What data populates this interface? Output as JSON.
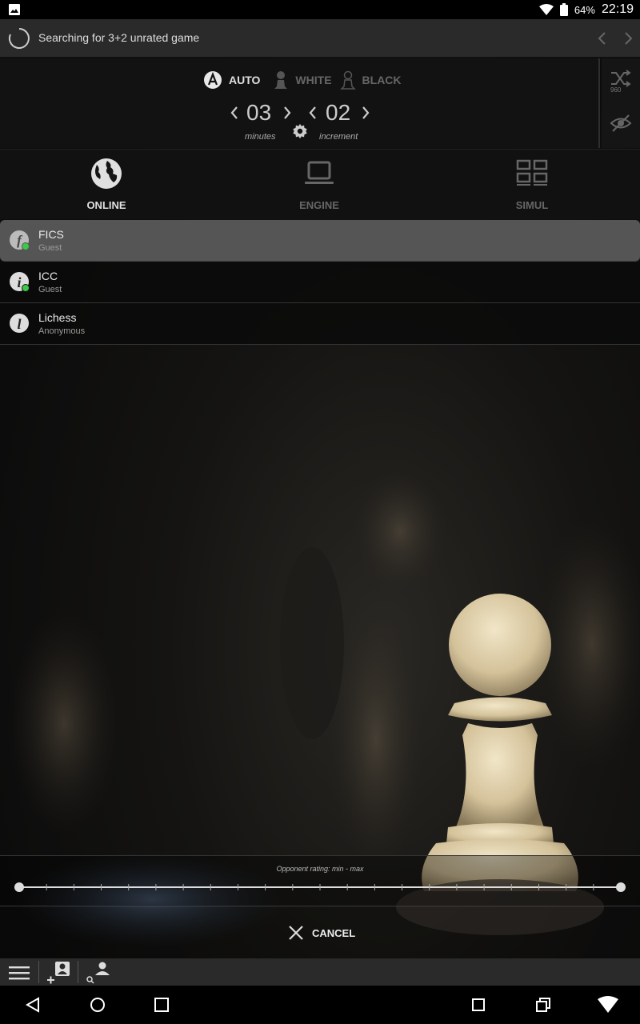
{
  "status_bar": {
    "battery": "64%",
    "time": "22:19"
  },
  "search": {
    "text": "Searching for 3+2 unrated game"
  },
  "color_options": [
    {
      "label": "AUTO",
      "selected": true
    },
    {
      "label": "WHITE",
      "selected": false
    },
    {
      "label": "BLACK",
      "selected": false
    }
  ],
  "time_control": {
    "minutes": "03",
    "minutes_label": "minutes",
    "increment": "02",
    "increment_label": "increment"
  },
  "side_buttons": {
    "chess960_label": "960"
  },
  "tabs": [
    {
      "label": "ONLINE",
      "icon": "globe-icon",
      "active": true
    },
    {
      "label": "ENGINE",
      "icon": "laptop-icon",
      "active": false
    },
    {
      "label": "SIMUL",
      "icon": "grid-icon",
      "active": false
    }
  ],
  "servers": [
    {
      "name": "FICS",
      "user": "Guest",
      "icon_letter": "f",
      "online": true,
      "selected": true
    },
    {
      "name": "ICC",
      "user": "Guest",
      "icon_letter": "i",
      "online": true,
      "selected": false
    },
    {
      "name": "Lichess",
      "user": "Anonymous",
      "icon_letter": "l",
      "online": false,
      "selected": false
    }
  ],
  "rating": {
    "label": "Opponent rating: min - max",
    "min_fraction": 0.0,
    "max_fraction": 1.0
  },
  "cancel": {
    "label": "CANCEL"
  },
  "colors": {
    "accent_green": "#3cc84a",
    "text_dim": "#777777",
    "text_bright": "#e0e0e0"
  }
}
